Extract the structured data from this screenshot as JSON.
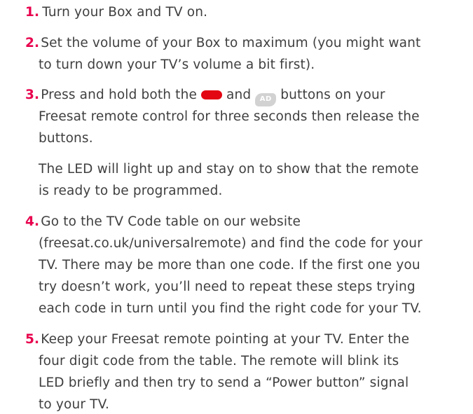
{
  "steps": [
    {
      "number": "1.",
      "lines": [
        "Turn your Box and TV on."
      ]
    },
    {
      "number": "2.",
      "lines": [
        "Set the volume of your Box to maximum (you might want",
        "to turn down your TV’s volume a bit first)."
      ]
    },
    {
      "number": "3.",
      "line1_before": "Press and hold both the",
      "line1_mid": "and",
      "line1_after": "buttons on your",
      "ad_button_label": "AD",
      "lines": [
        "Freesat remote control for three seconds then release the",
        "buttons."
      ],
      "note_lines": [
        "The LED will light up and stay on to show that the remote",
        "is ready to be programmed."
      ]
    },
    {
      "number": "4.",
      "lines": [
        "Go to the TV Code table on our website",
        "(freesat.co.uk/universalremote) and find the code for your",
        "TV. There may be more than one code. If the first one you",
        "try doesn’t work, you’ll need to repeat these steps trying",
        "each code in turn until you find the right code for your TV."
      ]
    },
    {
      "number": "5.",
      "lines": [
        "Keep your Freesat remote pointing at your TV. Enter the",
        "four digit code from the table. The remote will blink its",
        "LED briefly and then try to send a “Power button” signal",
        "to your TV."
      ]
    }
  ],
  "colors": {
    "step_number": "#e8004d",
    "body_text": "#3f3f3f",
    "red_button": "#e30613",
    "ad_button": "#d2d2d2"
  },
  "icons": {
    "red_button": "red-colour-button-icon",
    "ad_button": "ad-button-icon"
  }
}
